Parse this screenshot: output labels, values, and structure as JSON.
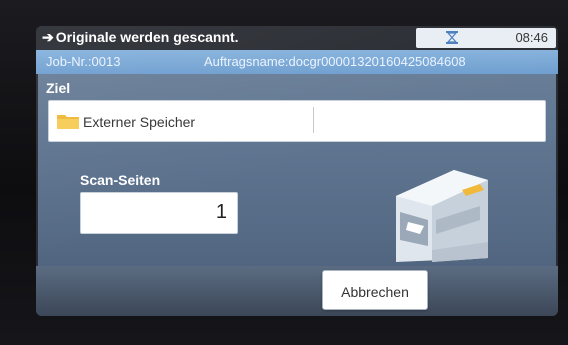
{
  "status": {
    "message": "Originale werden gescannt.",
    "arrow_icon": "arrow-right-icon",
    "busy_icon": "hourglass-icon",
    "time": "08:46"
  },
  "job": {
    "number": "Job-Nr.:0013",
    "name": "Auftragsname:docgr00001320160425084608"
  },
  "destination": {
    "label": "Ziel",
    "icon": "folder-icon",
    "value": "Externer Speicher"
  },
  "scan": {
    "label": "Scan-Seiten",
    "pages": "1"
  },
  "illustration": {
    "icon": "printer-scanner-icon"
  },
  "actions": {
    "cancel_label": "Abbrechen"
  },
  "colors": {
    "status_bar": "#2a2d33",
    "job_bar": "#7aa7d6",
    "screen_bg": "#5f7590",
    "folder": "#f0b93a"
  }
}
